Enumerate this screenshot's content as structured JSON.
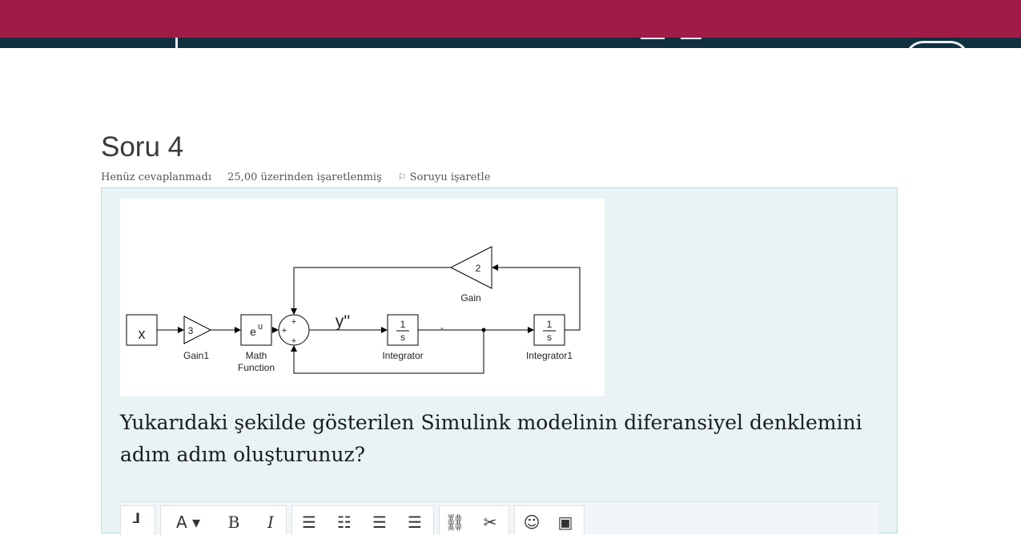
{
  "header": {
    "bar_color": "#a01c48",
    "band_color": "#11303f"
  },
  "question": {
    "title": "Soru 4",
    "status": "Henüz cevaplanmadı",
    "marks": "25,00 üzerinden işaretlenmiş",
    "flag_label": "Soruyu işaretle",
    "text": "Yukarıdaki şekilde gösterilen Simulink modelinin diferansiyel denklemini adım adım oluşturunuz?"
  },
  "diagram": {
    "x_label": "x",
    "gain1_value": "3",
    "gain1_label": "Gain1",
    "math_label_line1": "Math",
    "math_label_line2": "Function",
    "math_exponent": "u",
    "math_base": "e",
    "sum_signs_top": "+",
    "sum_signs_left": "+",
    "sum_signs_bottom": "+",
    "signal_label": "y''",
    "integrator_num": "1",
    "integrator_den": "s",
    "integrator_label": "Integrator",
    "integrator1_num": "1",
    "integrator1_den": "s",
    "integrator1_label": "Integrator1",
    "gain_value": "2",
    "gain_label": "Gain",
    "dash_label": "-"
  },
  "toolbar": {
    "buttons": [
      {
        "name": "paragraph-icon",
        "glyph": "┚"
      },
      {
        "name": "font-size-icon",
        "glyph": "A ▾"
      },
      {
        "name": "bold-icon",
        "glyph": "B"
      },
      {
        "name": "italic-icon",
        "glyph": "I"
      },
      {
        "name": "bullet-list-icon",
        "glyph": "☰"
      },
      {
        "name": "numbered-list-icon",
        "glyph": "☷"
      },
      {
        "name": "outdent-icon",
        "glyph": "☰"
      },
      {
        "name": "indent-icon",
        "glyph": "☰"
      },
      {
        "name": "link-icon",
        "glyph": "🔗"
      },
      {
        "name": "unlink-icon",
        "glyph": "⛓"
      },
      {
        "name": "emoji-icon",
        "glyph": "☺"
      },
      {
        "name": "image-icon",
        "glyph": "▣"
      }
    ]
  }
}
